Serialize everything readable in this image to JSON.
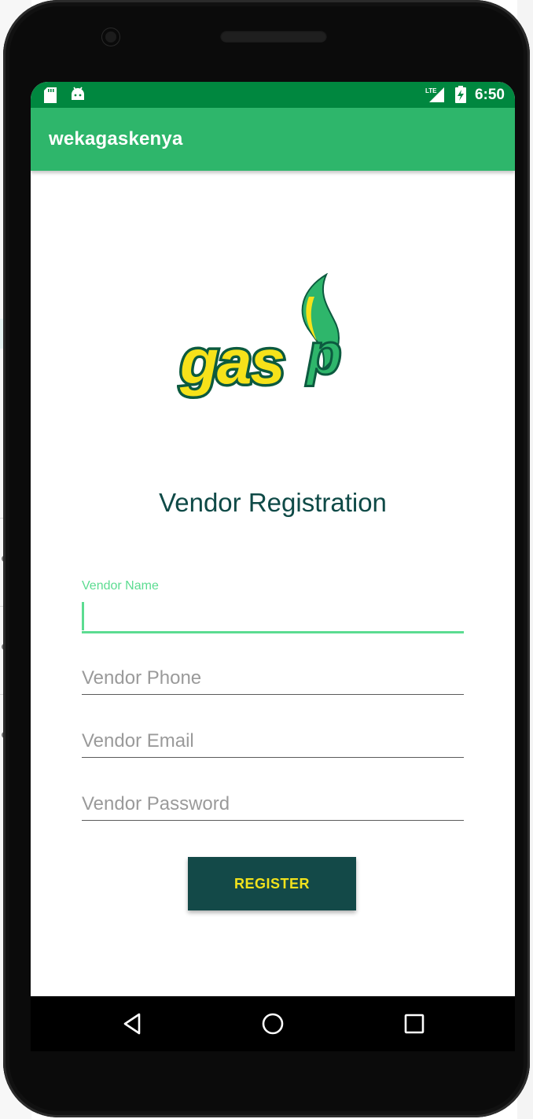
{
  "status_bar": {
    "time": "6:50",
    "network": "LTE"
  },
  "app_bar": {
    "title": "wekagaskenya"
  },
  "logo": {
    "text": "gas",
    "colors": {
      "yellow": "#f6e21a",
      "dark_green": "#0c5a3f",
      "green": "#2eb66b"
    }
  },
  "heading": "Vendor Registration",
  "form": {
    "name": {
      "label": "Vendor Name",
      "value": ""
    },
    "phone": {
      "placeholder": "Vendor Phone"
    },
    "email": {
      "placeholder": "Vendor Email"
    },
    "password": {
      "placeholder": "Vendor Password"
    },
    "submit_label": "REGISTER"
  },
  "colors": {
    "status_bar": "#00873f",
    "app_bar": "#2eb66b",
    "heading": "#0f4a47",
    "accent": "#5cdc91",
    "button_bg": "#134948",
    "button_text": "#f1e21c"
  },
  "nav": {
    "back": "back-icon",
    "home": "home-icon",
    "recents": "recents-icon"
  }
}
